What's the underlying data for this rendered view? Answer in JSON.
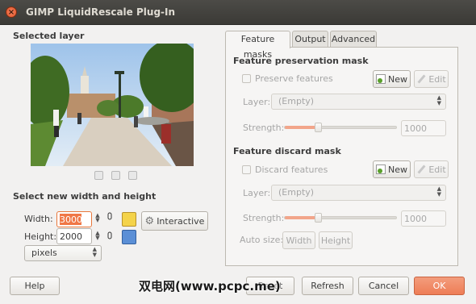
{
  "window": {
    "title": "GIMP LiquidRescale Plug-In"
  },
  "left": {
    "selected_layer_title": "Selected layer",
    "resize_title": "Select new width and height",
    "width_label": "Width:",
    "width_value": "3000",
    "height_label": "Height:",
    "height_value": "2000",
    "unit": "pixels",
    "interactive_label": "Interactive"
  },
  "tabs": [
    {
      "label": "Feature masks",
      "active": true
    },
    {
      "label": "Output",
      "active": false
    },
    {
      "label": "Advanced",
      "active": false
    }
  ],
  "preservation": {
    "title": "Feature preservation mask",
    "checkbox_label": "Preserve features",
    "new_label": "New",
    "edit_label": "Edit",
    "layer_label": "Layer:",
    "layer_value": "(Empty)",
    "strength_label": "Strength:",
    "strength_value": "1000",
    "strength_fraction": 0.3
  },
  "discard": {
    "title": "Feature discard mask",
    "checkbox_label": "Discard features",
    "new_label": "New",
    "edit_label": "Edit",
    "layer_label": "Layer:",
    "layer_value": "(Empty)",
    "strength_label": "Strength:",
    "strength_value": "1000",
    "strength_fraction": 0.3,
    "autosize_label": "Auto size:",
    "autosize_width": "Width",
    "autosize_height": "Height"
  },
  "footer": {
    "help": "Help",
    "reset": "Reset",
    "refresh": "Refresh",
    "cancel": "Cancel",
    "ok": "OK"
  },
  "watermark": "双电网(www.pcpc.me)",
  "colors": {
    "accent": "#ee7d56",
    "titlebar": "#3b3a36",
    "background": "#f2f1f0"
  }
}
